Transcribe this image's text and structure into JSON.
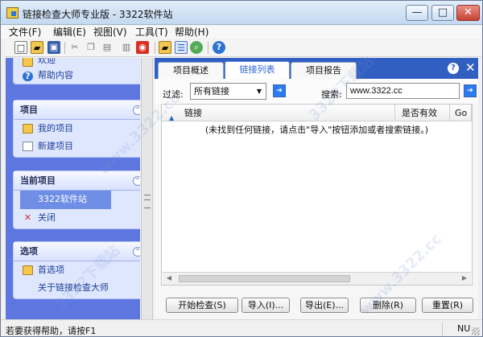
{
  "window": {
    "title": "链接检查大师专业版 - 3322软件站",
    "controls": {
      "minimize": "—",
      "maximize": "□",
      "close": "✕"
    }
  },
  "menus": [
    "文件(F)",
    "编辑(E)",
    "视图(V)",
    "工具(T)",
    "帮助(H)"
  ],
  "toolbar": {
    "buttons": [
      {
        "name": "new-document-icon",
        "glyph": "□"
      },
      {
        "name": "open-folder-icon",
        "glyph": "▰"
      },
      {
        "name": "save-icon",
        "glyph": "▣"
      },
      {
        "name": "cut-icon",
        "glyph": "✂"
      },
      {
        "name": "copy-icon",
        "glyph": "❐"
      },
      {
        "name": "paste-icon",
        "glyph": "▤"
      },
      {
        "name": "print-icon",
        "glyph": "▥"
      },
      {
        "name": "stop-icon",
        "glyph": "◉"
      },
      {
        "name": "folder-view-icon",
        "glyph": "▰"
      },
      {
        "name": "list-view-icon",
        "glyph": "☰"
      },
      {
        "name": "search-icon",
        "glyph": "⌕"
      },
      {
        "name": "help-icon",
        "glyph": "?"
      }
    ]
  },
  "sidebar": {
    "top_items": [
      {
        "label": "欢迎",
        "icon": "welcome-icon"
      },
      {
        "label": "帮助内容",
        "icon": "help-icon"
      }
    ],
    "panels": [
      {
        "title": "项目",
        "items": [
          {
            "label": "我的项目",
            "icon": "project-folder-icon"
          },
          {
            "label": "新建项目",
            "icon": "new-project-icon"
          }
        ]
      },
      {
        "title": "当前项目",
        "items": [
          {
            "label": "3322软件站",
            "icon": ""
          },
          {
            "label": "关闭",
            "icon": "close-icon"
          }
        ]
      },
      {
        "title": "选项",
        "items": [
          {
            "label": "首选项",
            "icon": "preferences-icon"
          },
          {
            "label": "关于链接检查大师",
            "icon": ""
          }
        ]
      }
    ]
  },
  "main": {
    "tabs": [
      "项目概述",
      "链接列表",
      "项目报告"
    ],
    "active_tab": "链接列表",
    "filter": {
      "label": "过滤:",
      "selected": "所有链接"
    },
    "search": {
      "label": "搜索:",
      "value": "www.3322.cc"
    },
    "table": {
      "columns": [
        "链接",
        "是否有效",
        "Go"
      ],
      "empty_message": "(未找到任何链接，请点击\"导入\"按钮添加或者搜索链接。)"
    },
    "actions": [
      "开始检查(S)",
      "导入(I)...",
      "导出(E)...",
      "删除(R)",
      "重置(R)"
    ]
  },
  "statusbar": {
    "text": "若要获得帮助，请按F1",
    "indicator": "NU"
  },
  "watermarks": [
    "3322下载站",
    "www.3322.cc",
    "3322下载站",
    "www.3322.cc"
  ],
  "colors": {
    "sidebar": "#5e77e0",
    "tab_bar": "#315fc1",
    "active_tab_text": "#2b64d9"
  }
}
